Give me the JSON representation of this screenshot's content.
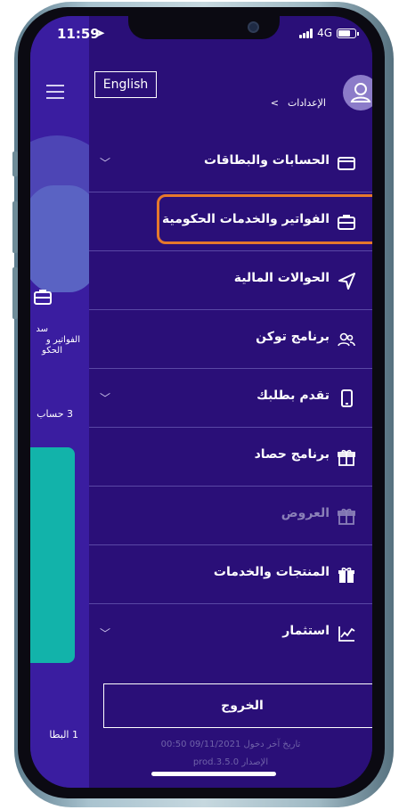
{
  "status_bar": {
    "time": "11:59",
    "network": "4G"
  },
  "background_page": {
    "text_1": "سد",
    "text_2": "الفواتير و",
    "text_3": "الحكو",
    "accounts_count": "3 حساب",
    "cards_count": "1 البطا"
  },
  "header": {
    "language_button": "English",
    "breadcrumb_title": "الإعدادات",
    "breadcrumb_sep": ">"
  },
  "menu": {
    "items": [
      {
        "label": "الحسابات والبطاقات",
        "icon": "card-icon",
        "chevron": true
      },
      {
        "label": "الفواتير والخدمات الحكومية",
        "icon": "briefcase-icon",
        "chevron": false
      },
      {
        "label": "الحوالات المالية",
        "icon": "send-icon",
        "chevron": false
      },
      {
        "label": "برنامج توكن",
        "icon": "users-icon",
        "chevron": false
      },
      {
        "label": "تقدم بطلبك",
        "icon": "phone-icon",
        "chevron": true
      },
      {
        "label": "برنامج حصاد",
        "icon": "gift-icon",
        "chevron": false
      },
      {
        "label": "العروض",
        "icon": "gift-icon",
        "chevron": false
      },
      {
        "label": "المنتجات والخدمات",
        "icon": "gift-icon",
        "chevron": false
      },
      {
        "label": "استثمار",
        "icon": "chart-icon",
        "chevron": true
      }
    ]
  },
  "footer": {
    "logout_label": "الخروج",
    "last_login_label": "تاريخ آخر دخول",
    "last_login_value": "09/11/2021 00:50",
    "version_label": "الإصدار",
    "version_value": "prod.3.5.0"
  },
  "colors": {
    "background": "#2a0f78",
    "highlight": "#e6782c",
    "teal": "#12b3aa"
  }
}
